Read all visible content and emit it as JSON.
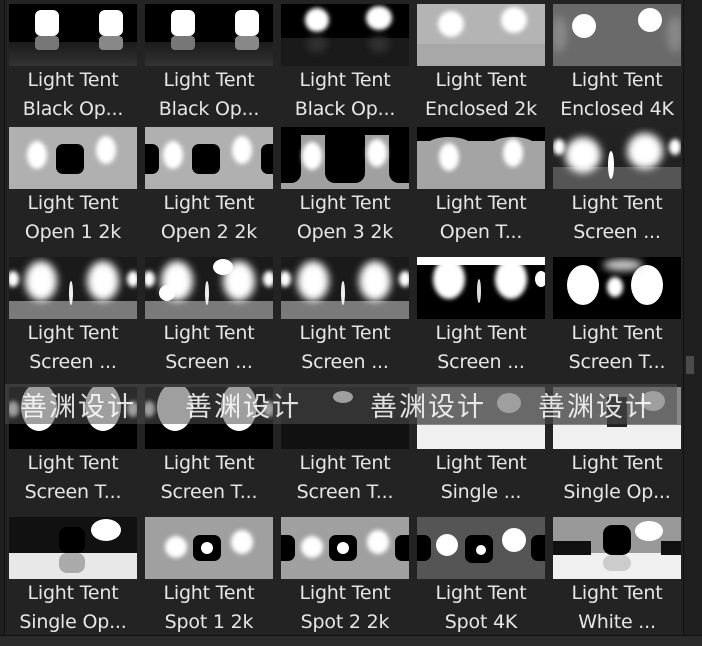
{
  "library": {
    "items": [
      {
        "line1": "Light Tent",
        "line2": "Black Op...",
        "style": "black1"
      },
      {
        "line1": "Light Tent",
        "line2": "Black Op...",
        "style": "black2"
      },
      {
        "line1": "Light Tent",
        "line2": "Black Op...",
        "style": "black3"
      },
      {
        "line1": "Light Tent",
        "line2": "Enclosed 2k",
        "style": "enc2"
      },
      {
        "line1": "Light Tent",
        "line2": "Enclosed 4K",
        "style": "enc4"
      },
      {
        "line1": "Light Tent",
        "line2": "Open 1 2k",
        "style": "open1"
      },
      {
        "line1": "Light Tent",
        "line2": "Open 2 2k",
        "style": "open2"
      },
      {
        "line1": "Light Tent",
        "line2": "Open 3 2k",
        "style": "open3"
      },
      {
        "line1": "Light Tent",
        "line2": "Open T...",
        "style": "opent"
      },
      {
        "line1": "Light Tent",
        "line2": "Screen ...",
        "style": "screen0"
      },
      {
        "line1": "Light Tent",
        "line2": "Screen ...",
        "style": "screen1"
      },
      {
        "line1": "Light Tent",
        "line2": "Screen ...",
        "style": "screen2"
      },
      {
        "line1": "Light Tent",
        "line2": "Screen ...",
        "style": "screen3"
      },
      {
        "line1": "Light Tent",
        "line2": "Screen ...",
        "style": "screen4"
      },
      {
        "line1": "Light Tent",
        "line2": "Screen T...",
        "style": "screent"
      },
      {
        "line1": "Light Tent",
        "line2": "Screen T...",
        "style": "st1"
      },
      {
        "line1": "Light Tent",
        "line2": "Screen T...",
        "style": "st2"
      },
      {
        "line1": "Light Tent",
        "line2": "Screen T...",
        "style": "st3"
      },
      {
        "line1": "Light Tent",
        "line2": "Single ...",
        "style": "single1"
      },
      {
        "line1": "Light Tent",
        "line2": "Single Op...",
        "style": "single2"
      },
      {
        "line1": "Light Tent",
        "line2": "Single Op...",
        "style": "single3"
      },
      {
        "line1": "Light Tent",
        "line2": "Spot 1 2k",
        "style": "spot1"
      },
      {
        "line1": "Light Tent",
        "line2": "Spot 2 2k",
        "style": "spot2"
      },
      {
        "line1": "Light Tent",
        "line2": "Spot 4K",
        "style": "spot4"
      },
      {
        "line1": "Light Tent",
        "line2": "White ...",
        "style": "white"
      }
    ]
  },
  "watermark": {
    "text": "善渊设计"
  }
}
